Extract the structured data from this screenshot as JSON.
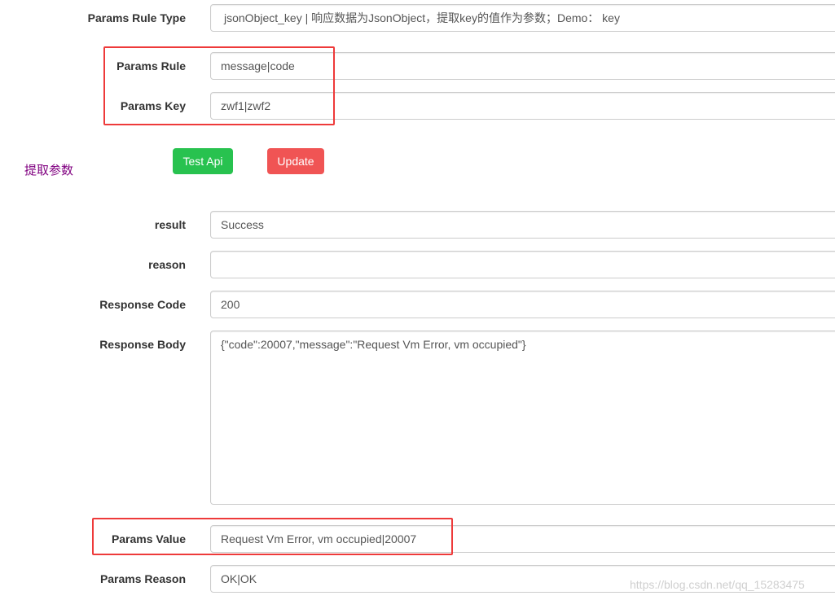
{
  "form": {
    "params_rule_type": {
      "label": "Params Rule Type",
      "value": "jsonObject_key | 响应数据为JsonObject，提取key的值作为参数；Demo：  key"
    },
    "params_rule": {
      "label": "Params Rule",
      "value": "message|code"
    },
    "params_key": {
      "label": "Params Key",
      "value": "zwf1|zwf2"
    },
    "result": {
      "label": "result",
      "value": "Success"
    },
    "reason": {
      "label": "reason",
      "value": ""
    },
    "response_code": {
      "label": "Response Code",
      "value": "200"
    },
    "response_body": {
      "label": "Response Body",
      "value": "{\"code\":20007,\"message\":\"Request Vm Error, vm occupied\"}"
    },
    "params_value": {
      "label": "Params Value",
      "value": "Request Vm Error, vm occupied|20007"
    },
    "params_reason": {
      "label": "Params Reason",
      "value": "OK|OK"
    }
  },
  "buttons": {
    "test_api": "Test Api",
    "update": "Update"
  },
  "side_note": "提取参数",
  "watermark": "https://blog.csdn.net/qq_15283475",
  "colors": {
    "test_button": "#28c24f",
    "update_button": "#f05454",
    "highlight_box": "#ee3a3a",
    "side_note": "#800080"
  }
}
